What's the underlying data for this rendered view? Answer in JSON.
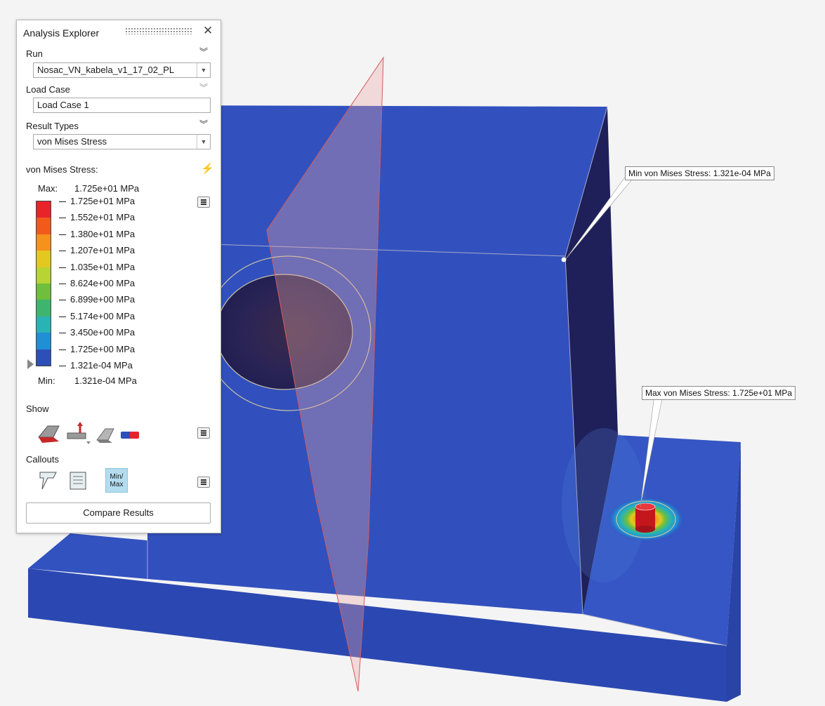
{
  "callouts": {
    "min": "Min von Mises Stress: 1.321e-04 MPa",
    "max": "Max von Mises Stress: 1.725e+01 MPa"
  },
  "panel": {
    "title": "Analysis Explorer",
    "run_label": "Run",
    "run_value": "Nosac_VN_kabela_v1_17_02_PL",
    "load_case_label": "Load Case",
    "load_case_value": "Load Case 1",
    "result_types_label": "Result Types",
    "result_type_value": "von Mises Stress",
    "legend_title": "von Mises Stress:",
    "legend_max_label": "Max:",
    "legend_max_value": "1.725e+01 MPa",
    "legend_min_label": "Min:",
    "legend_min_value": "1.321e-04 MPa",
    "legend_levels": [
      "1.725e+01 MPa",
      "1.552e+01 MPa",
      "1.380e+01 MPa",
      "1.207e+01 MPa",
      "1.035e+01 MPa",
      "8.624e+00 MPa",
      "6.899e+00 MPa",
      "5.174e+00 MPa",
      "3.450e+00 MPa",
      "1.725e+00 MPa",
      "1.321e-04 MPa"
    ],
    "legend_colors": [
      "#e8232a",
      "#f25a1c",
      "#f6911c",
      "#e3c81f",
      "#b7d433",
      "#6fbe3c",
      "#3db56e",
      "#28b3b5",
      "#1f8fd6",
      "#2d4fb8"
    ],
    "show_label": "Show",
    "callouts_label": "Callouts",
    "minmax_label_1": "Min/",
    "minmax_label_2": "Max",
    "compare_label": "Compare Results",
    "icons": {
      "close": "close-icon",
      "run_expand": "chevron-double-down-icon",
      "lightning": "lightning-icon"
    }
  }
}
